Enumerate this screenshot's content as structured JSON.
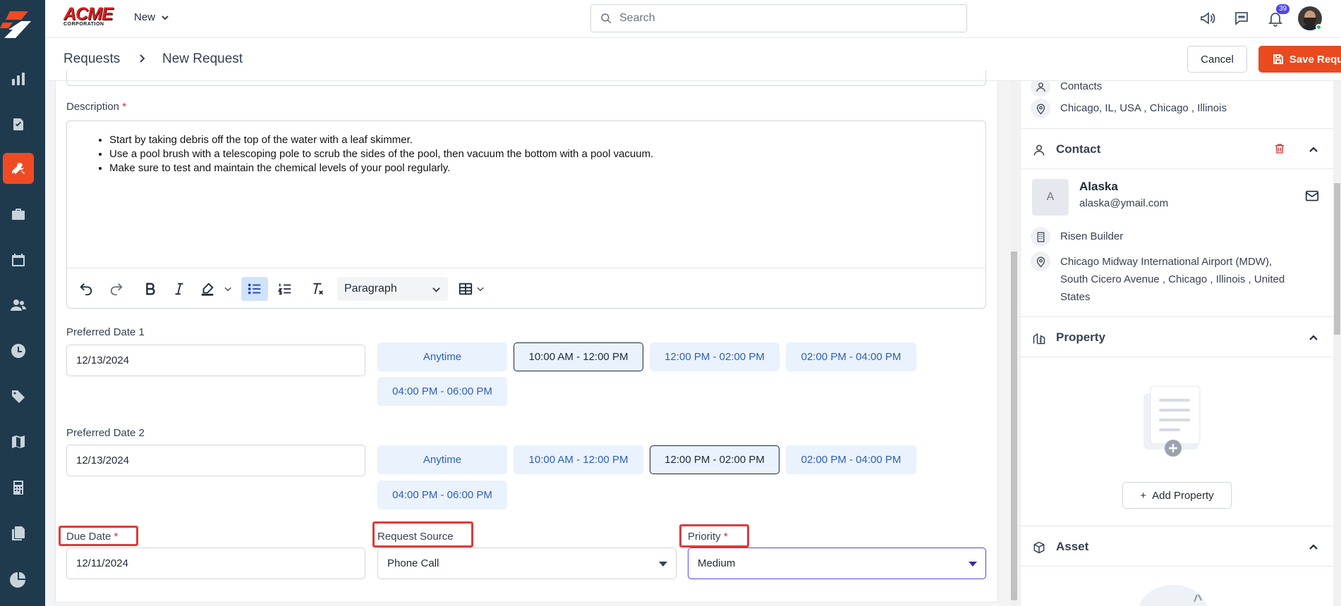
{
  "topbar": {
    "new_label": "New",
    "search_placeholder": "Search",
    "notification_count": "39"
  },
  "breadcrumb": {
    "parent": "Requests",
    "current": "New Request"
  },
  "actions": {
    "cancel_label": "Cancel",
    "save_label": "Save Request"
  },
  "form": {
    "description_label": "Description",
    "description_items": [
      "Start by taking debris off the top of the water with a leaf skimmer.",
      "Use a pool brush with a telescoping pole to scrub the sides of the pool, then vacuum the bottom with a pool vacuum.",
      "Make sure to test and maintain the chemical levels of your pool regularly."
    ],
    "block_format": "Paragraph",
    "preferred_date_1": {
      "label": "Preferred Date 1",
      "value": "12/13/2024",
      "slots": [
        "Anytime",
        "10:00 AM - 12:00 PM",
        "12:00 PM - 02:00 PM",
        "02:00 PM - 04:00 PM",
        "04:00 PM - 06:00 PM"
      ],
      "selected": "10:00 AM - 12:00 PM"
    },
    "preferred_date_2": {
      "label": "Preferred Date 2",
      "value": "12/13/2024",
      "slots": [
        "Anytime",
        "10:00 AM - 12:00 PM",
        "12:00 PM - 02:00 PM",
        "02:00 PM - 04:00 PM",
        "04:00 PM - 06:00 PM"
      ],
      "selected": "12:00 PM - 02:00 PM"
    },
    "due_date": {
      "label": "Due Date",
      "value": "12/11/2024"
    },
    "request_source": {
      "label": "Request Source",
      "value": "Phone Call"
    },
    "priority": {
      "label": "Priority",
      "value": "Medium"
    }
  },
  "panel": {
    "contacts_text": "Contacts",
    "client_location": "Chicago, IL, USA , Chicago , Illinois",
    "contact_section": {
      "title": "Contact",
      "avatar_initial": "A",
      "name": "Alaska",
      "email": "alaska@ymail.com",
      "company": "Risen Builder",
      "address_lines": [
        "Chicago Midway International Airport (MDW),",
        "South Cicero Avenue , Chicago , Illinois , United",
        "States"
      ]
    },
    "property_section": {
      "title": "Property",
      "add_label": "Add Property"
    },
    "asset_section": {
      "title": "Asset"
    }
  },
  "colors": {
    "sidebar_bg": "#1f3a4d",
    "accent": "#e94a1f",
    "slot_bg": "#e9f2fd",
    "slot_text": "#2f5fb5",
    "focus": "#4f46e5",
    "highlight_box": "#e03a3a"
  }
}
